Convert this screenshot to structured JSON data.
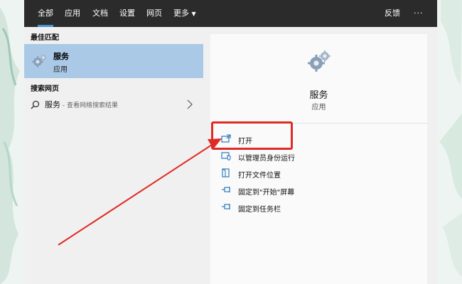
{
  "topbar": {
    "tabs": [
      {
        "label": "全部",
        "active": true
      },
      {
        "label": "应用"
      },
      {
        "label": "文档"
      },
      {
        "label": "设置"
      },
      {
        "label": "网页"
      },
      {
        "label": "更多"
      }
    ],
    "feedback_label": "反馈",
    "more_options_label": "···"
  },
  "left": {
    "best_match_header": "最佳匹配",
    "best_match": {
      "title": "服务",
      "subtitle": "应用",
      "icon": "gears-icon"
    },
    "search_web_header": "搜索网页",
    "web_result": {
      "query": "服务",
      "hint": " - 查看网络搜索结果",
      "icon": "search-icon"
    }
  },
  "right": {
    "app_name": "服务",
    "app_type": "应用",
    "actions": [
      {
        "label": "打开",
        "icon": "open-icon"
      },
      {
        "label": "以管理员身份运行",
        "icon": "run-as-admin-icon"
      },
      {
        "label": "打开文件位置",
        "icon": "file-location-icon"
      },
      {
        "label": "固定到\"开始\"屏幕",
        "icon": "pin-icon"
      },
      {
        "label": "固定到任务栏",
        "icon": "pin-icon"
      }
    ]
  },
  "colors": {
    "accent": "#4b8fd4",
    "selection": "#aac9e6",
    "annotation": "#e02a25"
  }
}
